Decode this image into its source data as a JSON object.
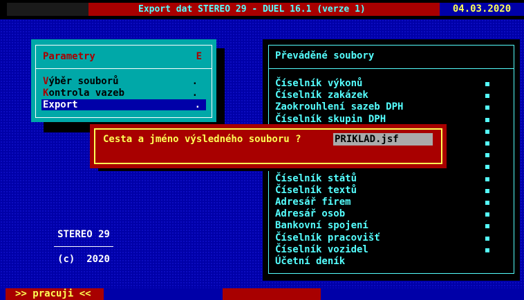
{
  "titlebar": {
    "title": "Export dat STEREO 29 - DUEL 16.1  (verze 1)",
    "date": "04.03.2020"
  },
  "menu": {
    "title": "Parametry",
    "key": "E",
    "items": [
      {
        "hot": "V",
        "rest": "ýběr souborů",
        "dot": "."
      },
      {
        "hot": "K",
        "rest": "ontrola vazeb",
        "dot": "."
      },
      {
        "hot": "",
        "rest": "Export",
        "dot": "."
      }
    ]
  },
  "files": {
    "title": "Převáděné soubory",
    "rows": [
      "Číselník výkonů",
      "Číselník zakázek",
      "Zaokrouhlení sazeb DPH",
      "Číselník skupin DPH",
      "",
      "",
      "",
      "",
      "Číselník států",
      "Číselník textů",
      "Adresář firem",
      "Adresář osob",
      "Bankovní spojení",
      "Číselník pracovišť",
      "Číselník vozidel",
      "Účetní deník"
    ]
  },
  "dialog": {
    "label": "Cesta a jméno výsledného souboru ?",
    "value": "PRIKLAD.jsf"
  },
  "stereo": {
    "name": "STEREO 29",
    "copyright": "(c)  2020"
  },
  "statusbar": {
    "text": ">> pracuji <<"
  },
  "colors": {
    "background": "#0000a8",
    "cyan": "#55ffff",
    "red": "#a80000",
    "yellow": "#ffff55"
  }
}
